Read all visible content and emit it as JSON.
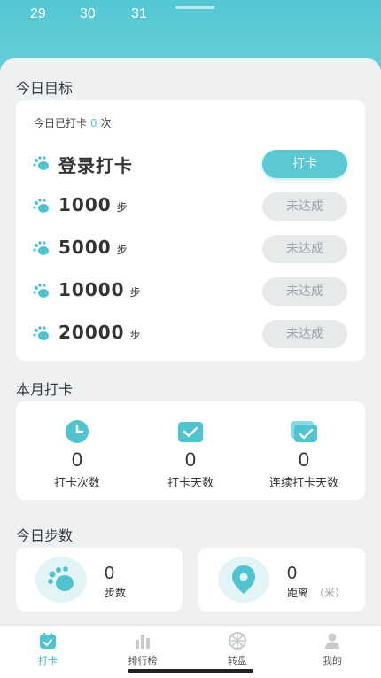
{
  "calendar": {
    "days": [
      "29",
      "30",
      "31"
    ]
  },
  "today_goal": {
    "title": "今日目标",
    "checkin_prefix": "今日已打卡",
    "checkin_count": "0",
    "checkin_suffix": "次",
    "items": [
      {
        "label": "登录打卡",
        "unit": "",
        "button": "打卡",
        "status": "active"
      },
      {
        "label": "1000",
        "unit": "步",
        "button": "未达成",
        "status": "inactive"
      },
      {
        "label": "5000",
        "unit": "步",
        "button": "未达成",
        "status": "inactive"
      },
      {
        "label": "10000",
        "unit": "步",
        "button": "未达成",
        "status": "inactive"
      },
      {
        "label": "20000",
        "unit": "步",
        "button": "未达成",
        "status": "inactive"
      }
    ]
  },
  "month_checkin": {
    "title": "本月打卡",
    "stats": [
      {
        "value": "0",
        "label": "打卡次数",
        "icon": "clock-icon"
      },
      {
        "value": "0",
        "label": "打卡天数",
        "icon": "calendar-check-icon"
      },
      {
        "value": "0",
        "label": "连续打卡天数",
        "icon": "chat-check-icon"
      }
    ]
  },
  "today_steps": {
    "title": "今日步数",
    "steps": {
      "value": "0",
      "label": "步数",
      "icon": "footprint-icon"
    },
    "distance": {
      "value": "0",
      "label": "距离",
      "sub": "（米）",
      "icon": "location-pin-icon"
    }
  },
  "tabbar": {
    "tabs": [
      {
        "label": "打卡",
        "icon": "calendar-icon",
        "active": true
      },
      {
        "label": "排行榜",
        "icon": "bar-chart-icon",
        "active": false
      },
      {
        "label": "转盘",
        "icon": "wheel-icon",
        "active": false
      },
      {
        "label": "我的",
        "icon": "user-icon",
        "active": false
      }
    ]
  },
  "colors": {
    "accent": "#5bc9d4",
    "header": "#53c7d2",
    "inactive_pill": "#e7eaeb"
  }
}
